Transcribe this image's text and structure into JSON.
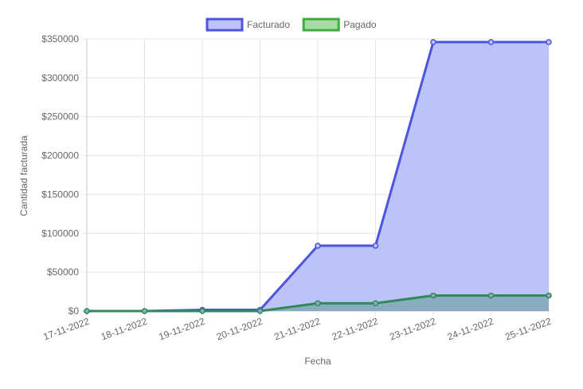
{
  "chart_data": {
    "type": "area",
    "categories": [
      "17-11-2022",
      "18-11-2022",
      "19-11-2022",
      "20-11-2022",
      "21-11-2022",
      "22-11-2022",
      "23-11-2022",
      "24-11-2022",
      "25-11-2022"
    ],
    "series": [
      {
        "name": "Facturado",
        "values": [
          0,
          0,
          1500,
          1500,
          84000,
          84000,
          346000,
          346000,
          346000
        ],
        "color": "#4b55e0",
        "fill_color": "#bdc2f7"
      },
      {
        "name": "Pagado",
        "values": [
          0,
          0,
          0,
          0,
          10000,
          10000,
          20000,
          20000,
          20000
        ],
        "color": "#2e8b57",
        "fill_color": "#8aacc0"
      }
    ],
    "xlabel": "Fecha",
    "ylabel": "Cantidad facturada",
    "ylim": [
      0,
      350000
    ],
    "yticks": [
      0,
      50000,
      100000,
      150000,
      200000,
      250000,
      300000,
      350000
    ],
    "ytick_labels": [
      "$0",
      "$50000",
      "$100000",
      "$150000",
      "$200000",
      "$250000",
      "$300000",
      "$350000"
    ],
    "grid": true,
    "legend_position": "top-center",
    "legend_items": [
      {
        "label": "Facturado",
        "swatch_fill": "#bdc2f7",
        "swatch_border": "#4b55e0"
      },
      {
        "label": "Pagado",
        "swatch_fill": "#a8dba8",
        "swatch_border": "#3cae3c"
      }
    ]
  }
}
